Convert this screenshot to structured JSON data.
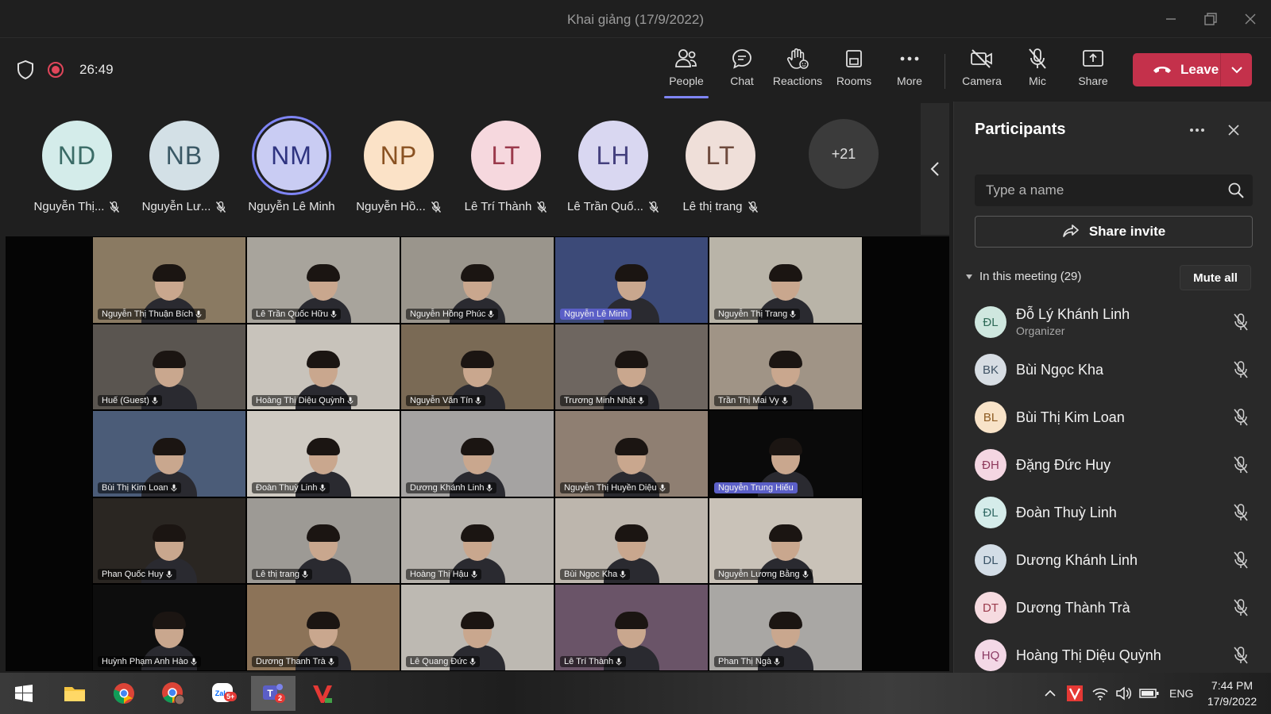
{
  "window": {
    "title": "Khai giảng (17/9/2022)"
  },
  "toolbar": {
    "timer": "26:49",
    "buttons": {
      "people": "People",
      "chat": "Chat",
      "reactions": "Reactions",
      "rooms": "Rooms",
      "more": "More",
      "camera": "Camera",
      "mic": "Mic",
      "share": "Share"
    },
    "leave_label": "Leave",
    "accent_color": "#7f85f5",
    "leave_color": "#c4314b"
  },
  "avatar_strip": {
    "items": [
      {
        "initials": "ND",
        "name": "Nguyễn Thị...",
        "bg": "#d4ecea",
        "fg": "#3a6b66"
      },
      {
        "initials": "NB",
        "name": "Nguyễn Lư...",
        "bg": "#d3e0e6",
        "fg": "#3a5865"
      },
      {
        "initials": "NM",
        "name": "Nguyễn Lê Minh",
        "bg": "#c9ccf3",
        "fg": "#2f3480"
      },
      {
        "initials": "NP",
        "name": "Nguyễn Hồ...",
        "bg": "#fbe2c7",
        "fg": "#8a5222"
      },
      {
        "initials": "LT",
        "name": "Lê Trí Thành",
        "bg": "#f6d8de",
        "fg": "#9b3a4c"
      },
      {
        "initials": "LH",
        "name": "Lê Trần Quố...",
        "bg": "#d9d7f1",
        "fg": "#44407e"
      },
      {
        "initials": "LT",
        "name": "Lê thị trang",
        "bg": "#efdfd9",
        "fg": "#6e4a3d"
      }
    ],
    "overflow": "+21"
  },
  "video_tiles": [
    {
      "name": "Nguyễn Thị Thuận Bích",
      "bg": "#8a7a62",
      "highlight": false
    },
    {
      "name": "Lê Trần Quốc Hữu",
      "bg": "#a8a49c",
      "highlight": false
    },
    {
      "name": "Nguyễn Hồng Phúc",
      "bg": "#9a958c",
      "highlight": false
    },
    {
      "name": "Nguyễn Lê Minh",
      "bg": "#3c4a78",
      "highlight": true
    },
    {
      "name": "Nguyễn Thị Trang",
      "bg": "#b9b4a8",
      "highlight": false
    },
    {
      "name": "Huế (Guest)",
      "bg": "#5a5550",
      "highlight": false
    },
    {
      "name": "Hoàng Thị Diệu Quỳnh",
      "bg": "#c8c3bb",
      "highlight": false
    },
    {
      "name": "Nguyễn Văn Tín",
      "bg": "#7a6a55",
      "highlight": false
    },
    {
      "name": "Trương Minh Nhật",
      "bg": "#6e6660",
      "highlight": false
    },
    {
      "name": "Trần Thị Mai Vy",
      "bg": "#a09486",
      "highlight": false
    },
    {
      "name": "Bùi Thị Kim Loan",
      "bg": "#4b5c78",
      "highlight": false
    },
    {
      "name": "Đoàn Thuỳ Linh",
      "bg": "#cfcac2",
      "highlight": false
    },
    {
      "name": "Dương Khánh Linh",
      "bg": "#a5a3a2",
      "highlight": false
    },
    {
      "name": "Nguyễn Thị Huyền Diệu",
      "bg": "#8f7f72",
      "highlight": false
    },
    {
      "name": "Nguyễn Trung Hiếu",
      "bg": "#0a0a0a",
      "highlight": true
    },
    {
      "name": "Phan Quốc Huy",
      "bg": "#2a2622",
      "highlight": false
    },
    {
      "name": "Lê thị trang",
      "bg": "#9d9a95",
      "highlight": false
    },
    {
      "name": "Hoàng Thị Hậu",
      "bg": "#b5b1ab",
      "highlight": false
    },
    {
      "name": "Bùi Ngọc Kha",
      "bg": "#bdb6ad",
      "highlight": false
    },
    {
      "name": "Nguyễn Lương Bằng",
      "bg": "#c9c2b8",
      "highlight": false
    },
    {
      "name": "Huỳnh Phạm Anh Hào",
      "bg": "#0d0d0d",
      "highlight": false
    },
    {
      "name": "Dương Thanh Trà",
      "bg": "#8c7358",
      "highlight": false
    },
    {
      "name": "Lê Quang Đức",
      "bg": "#bdb9b2",
      "highlight": false
    },
    {
      "name": "Lê Trí Thành",
      "bg": "#6a5468",
      "highlight": false
    },
    {
      "name": "Phan Thị Ngà",
      "bg": "#a9a7a4",
      "highlight": false
    }
  ],
  "panel": {
    "title": "Participants",
    "search_placeholder": "Type a name",
    "share_invite": "Share invite",
    "section_label": "In this meeting (29)",
    "mute_all": "Mute all",
    "participants": [
      {
        "initials": "ĐL",
        "name": "Đỗ Lý Khánh Linh",
        "role": "Organizer",
        "bg": "#cfe7df",
        "fg": "#2f6a57"
      },
      {
        "initials": "BK",
        "name": "Bùi Ngọc Kha",
        "role": "",
        "bg": "#d7dde3",
        "fg": "#3e5163"
      },
      {
        "initials": "BL",
        "name": "Bùi Thị Kim Loan",
        "role": "",
        "bg": "#f8e3c8",
        "fg": "#8d5b22"
      },
      {
        "initials": "ĐH",
        "name": "Đặng Đức Huy",
        "role": "",
        "bg": "#f4d6e2",
        "fg": "#8e3a5c"
      },
      {
        "initials": "ĐL",
        "name": "Đoàn Thuỳ Linh",
        "role": "",
        "bg": "#d5ecea",
        "fg": "#326a65"
      },
      {
        "initials": "DL",
        "name": "Dương Khánh Linh",
        "role": "",
        "bg": "#d3dde6",
        "fg": "#3b5468"
      },
      {
        "initials": "DT",
        "name": "Dương Thành Trà",
        "role": "",
        "bg": "#f6dbe0",
        "fg": "#9a3a4b"
      },
      {
        "initials": "HQ",
        "name": "Hoàng Thị Diệu Quỳnh",
        "role": "",
        "bg": "#f3d8e6",
        "fg": "#8b3a63"
      }
    ]
  },
  "taskbar": {
    "language": "ENG",
    "time": "7:44 PM",
    "date": "17/9/2022",
    "zalo_badge": "5+",
    "teams_badge": "2"
  }
}
